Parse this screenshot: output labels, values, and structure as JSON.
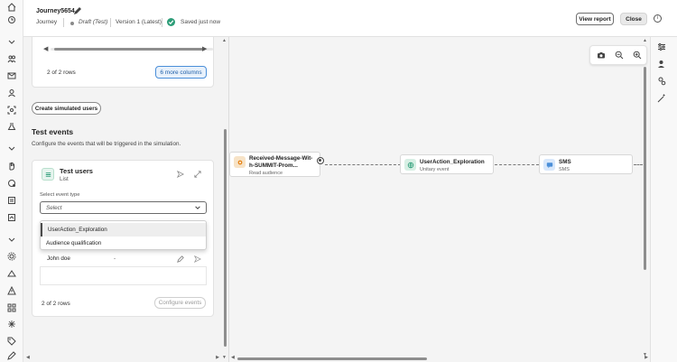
{
  "header": {
    "journey_name": "Journey5654",
    "type_label": "Journey",
    "status_label": "Draft (Test)",
    "version_label": "Version 1 (Latest)",
    "saved_label": "Saved just now",
    "view_report_label": "View report",
    "close_label": "Close"
  },
  "left_panel": {
    "table_card": {
      "rows_count": "2 of 2 rows",
      "more_columns_label": "6 more columns"
    },
    "create_users_label": "Create simulated users",
    "test_events": {
      "title": "Test events",
      "description": "Configure the events that will be triggered in the simulation.",
      "card": {
        "title": "Test users",
        "subtitle": "List",
        "select_label": "Select event type",
        "select_placeholder": "Select",
        "options": [
          "UserAction_Exploration",
          "Audience qualification"
        ],
        "rows": [
          {
            "name": "John doe",
            "value": "-"
          }
        ],
        "rows_count": "2 of 2 rows",
        "configure_label": "Configure events"
      }
    }
  },
  "canvas": {
    "nodes": [
      {
        "title": "Received-Message-Wit-h-SUMMIT-Prom...",
        "subtitle": "Read audience",
        "icon": "audience-icon",
        "color": "#f7e3c7"
      },
      {
        "title": "UserAction_Exploration",
        "subtitle": "Unitary event",
        "icon": "globe-event-icon",
        "color": "#d7efe4"
      },
      {
        "title": "SMS",
        "subtitle": "SMS",
        "icon": "sms-icon",
        "color": "#d9e8fb"
      }
    ]
  },
  "colors": {
    "accent_blue": "#4b8fd9",
    "success_green": "#2d9d78"
  }
}
